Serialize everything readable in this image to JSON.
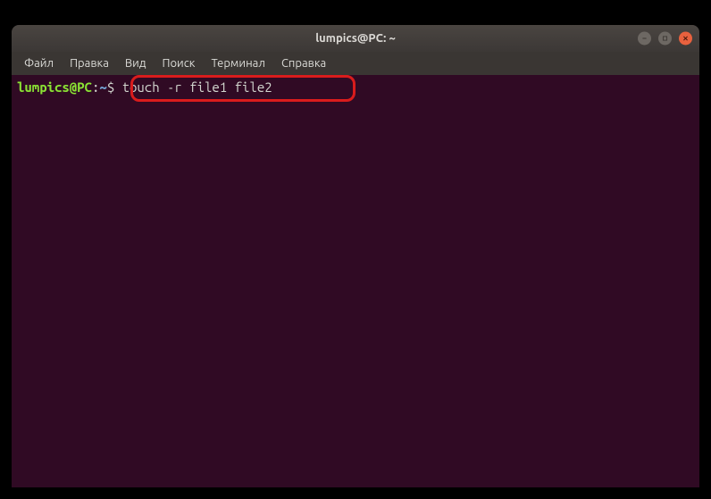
{
  "window": {
    "title": "lumpics@PC: ~"
  },
  "menubar": {
    "items": [
      {
        "label": "Файл"
      },
      {
        "label": "Правка"
      },
      {
        "label": "Вид"
      },
      {
        "label": "Поиск"
      },
      {
        "label": "Терминал"
      },
      {
        "label": "Справка"
      }
    ]
  },
  "terminal": {
    "prompt_user": "lumpics@PC",
    "prompt_colon": ":",
    "prompt_path": "~",
    "prompt_dollar": "$",
    "command": " touch -r file1 file2"
  }
}
